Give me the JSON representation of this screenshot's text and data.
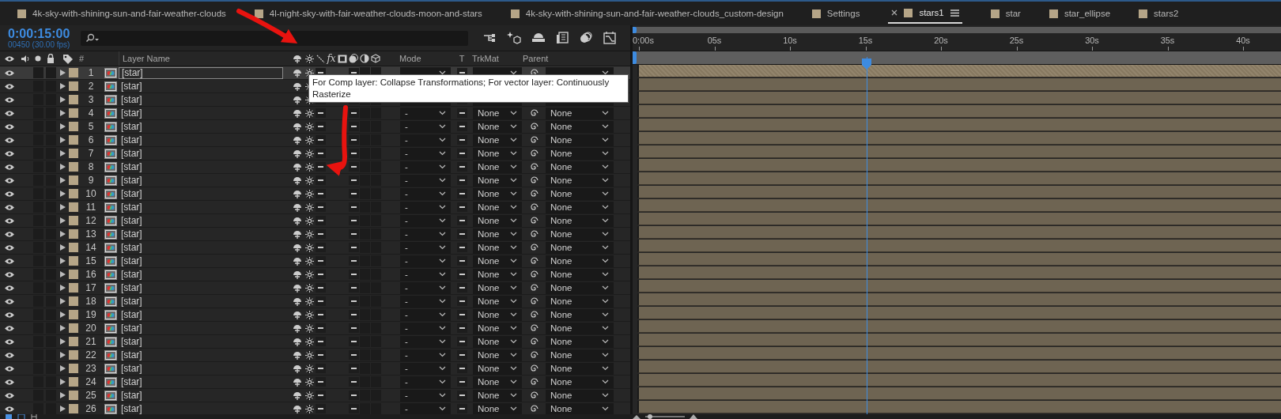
{
  "tabs": [
    {
      "label": "4k-sky-with-shining-sun-and-fair-weather-clouds",
      "selected": false
    },
    {
      "label": "4l-night-sky-with-fair-weather-clouds-moon-and-stars",
      "selected": false
    },
    {
      "label": "4k-sky-with-shining-sun-and-fair-weather-clouds_custom-design",
      "selected": false
    },
    {
      "label": "Settings",
      "selected": false
    },
    {
      "label": "stars1",
      "selected": true
    },
    {
      "label": "star",
      "selected": false
    },
    {
      "label": "star_ellipse",
      "selected": false
    },
    {
      "label": "stars2",
      "selected": false
    }
  ],
  "timecode": "0:00:15:00",
  "frame_info": "00450 (30.00 fps)",
  "columns": {
    "number": "#",
    "layer_name": "Layer Name",
    "fx": "fx",
    "mode": "Mode",
    "t": "T",
    "trkmat": "TrkMat",
    "parent": "Parent"
  },
  "layers": [
    {
      "number": "1",
      "name": "[star]",
      "selected": true
    },
    {
      "number": "2",
      "name": "[star]",
      "selected": false
    },
    {
      "number": "3",
      "name": "[star]",
      "selected": false
    },
    {
      "number": "4",
      "name": "[star]",
      "mode": "-",
      "trkmat": "None",
      "parent": "None",
      "selected": false
    },
    {
      "number": "5",
      "name": "[star]",
      "mode": "-",
      "trkmat": "None",
      "parent": "None",
      "selected": false
    },
    {
      "number": "6",
      "name": "[star]",
      "mode": "-",
      "trkmat": "None",
      "parent": "None",
      "selected": false
    },
    {
      "number": "7",
      "name": "[star]",
      "mode": "-",
      "trkmat": "None",
      "parent": "None",
      "selected": false
    },
    {
      "number": "8",
      "name": "[star]",
      "mode": "-",
      "trkmat": "None",
      "parent": "None",
      "selected": false
    },
    {
      "number": "9",
      "name": "[star]",
      "mode": "-",
      "trkmat": "None",
      "parent": "None",
      "selected": false
    },
    {
      "number": "10",
      "name": "[star]",
      "mode": "-",
      "trkmat": "None",
      "parent": "None",
      "selected": false
    },
    {
      "number": "11",
      "name": "[star]",
      "mode": "-",
      "trkmat": "None",
      "parent": "None",
      "selected": false
    },
    {
      "number": "12",
      "name": "[star]",
      "mode": "-",
      "trkmat": "None",
      "parent": "None",
      "selected": false
    },
    {
      "number": "13",
      "name": "[star]",
      "mode": "-",
      "trkmat": "None",
      "parent": "None",
      "selected": false
    },
    {
      "number": "14",
      "name": "[star]",
      "mode": "-",
      "trkmat": "None",
      "parent": "None",
      "selected": false
    },
    {
      "number": "15",
      "name": "[star]",
      "mode": "-",
      "trkmat": "None",
      "parent": "None",
      "selected": false
    },
    {
      "number": "16",
      "name": "[star]",
      "mode": "-",
      "trkmat": "None",
      "parent": "None",
      "selected": false
    },
    {
      "number": "17",
      "name": "[star]",
      "mode": "-",
      "trkmat": "None",
      "parent": "None",
      "selected": false
    },
    {
      "number": "18",
      "name": "[star]",
      "mode": "-",
      "trkmat": "None",
      "parent": "None",
      "selected": false
    },
    {
      "number": "19",
      "name": "[star]",
      "mode": "-",
      "trkmat": "None",
      "parent": "None",
      "selected": false
    },
    {
      "number": "20",
      "name": "[star]",
      "mode": "-",
      "trkmat": "None",
      "parent": "None",
      "selected": false
    },
    {
      "number": "21",
      "name": "[star]",
      "mode": "-",
      "trkmat": "None",
      "parent": "None",
      "selected": false
    },
    {
      "number": "22",
      "name": "[star]",
      "mode": "-",
      "trkmat": "None",
      "parent": "None",
      "selected": false
    },
    {
      "number": "23",
      "name": "[star]",
      "mode": "-",
      "trkmat": "None",
      "parent": "None",
      "selected": false
    },
    {
      "number": "24",
      "name": "[star]",
      "mode": "-",
      "trkmat": "None",
      "parent": "None",
      "selected": false
    },
    {
      "number": "25",
      "name": "[star]",
      "mode": "-",
      "trkmat": "None",
      "parent": "None",
      "selected": false
    },
    {
      "number": "26",
      "name": "[star]",
      "mode": "-",
      "trkmat": "None",
      "parent": "None",
      "selected": false
    }
  ],
  "tooltip": "For Comp layer: Collapse Transformations; For vector layer: Continuously Rasterize",
  "ruler": {
    "ticks": [
      "0:00s",
      "05s",
      "10s",
      "15s",
      "20s",
      "25s",
      "30s",
      "35s",
      "40s"
    ]
  },
  "playhead": {
    "level": 0.361
  },
  "zoom": {
    "level": 0.12
  }
}
